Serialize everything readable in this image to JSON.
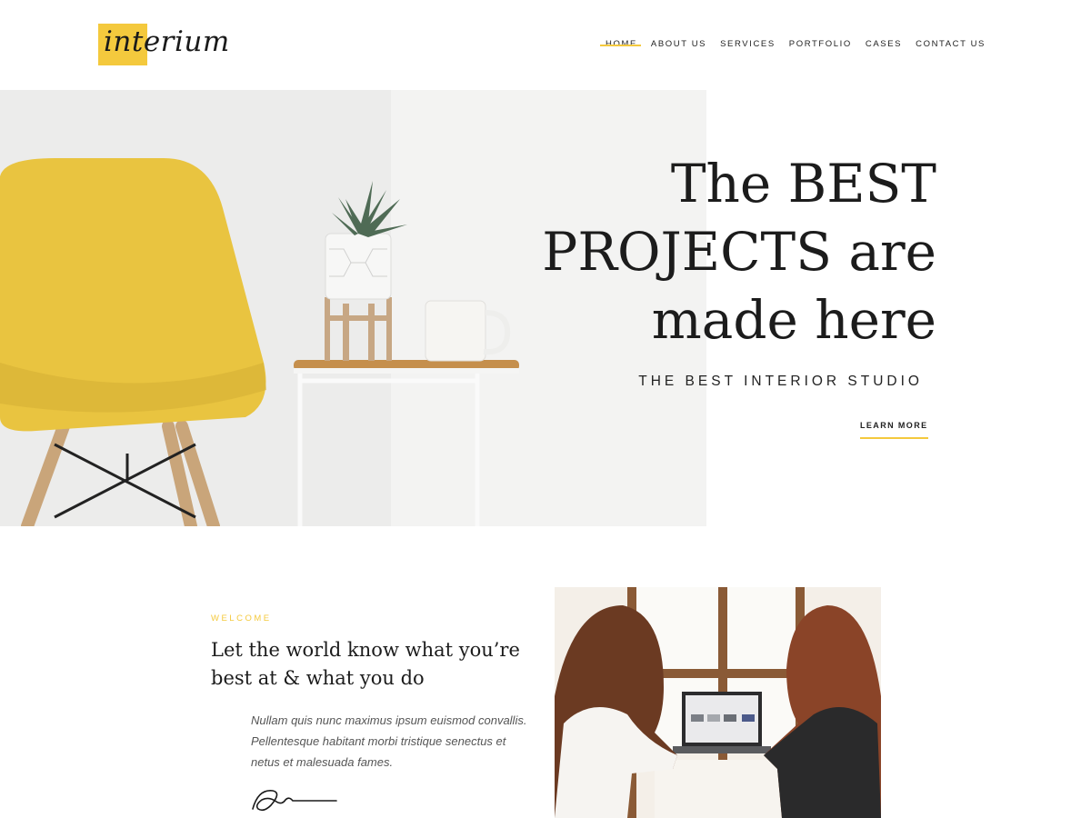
{
  "header": {
    "logo_text": "interium",
    "nav": [
      {
        "label": "HOME",
        "active": true
      },
      {
        "label": "ABOUT US"
      },
      {
        "label": "SERVICES"
      },
      {
        "label": "PORTFOLIO"
      },
      {
        "label": "CASES"
      },
      {
        "label": "CONTACT US"
      }
    ]
  },
  "hero": {
    "title": "The BEST\nPROJECTS are\nmade here",
    "subtitle": "THE BEST INTERIOR STUDIO",
    "cta_label": "LEARN MORE",
    "image_icon": "chair-plant-mug-photo"
  },
  "welcome": {
    "label": "WELCOME",
    "heading": "Let the world know what you’re best at & what you do",
    "body": "Nullam quis nunc maximus ipsum euismod convallis. Pellentesque habitant morbi tristique senectus et netus et malesuada fames.",
    "image_icon": "team-meeting-photo"
  },
  "colors": {
    "accent": "#f4c93d",
    "text": "#1c1c1c",
    "hero_bg": "#f2f2f1"
  }
}
